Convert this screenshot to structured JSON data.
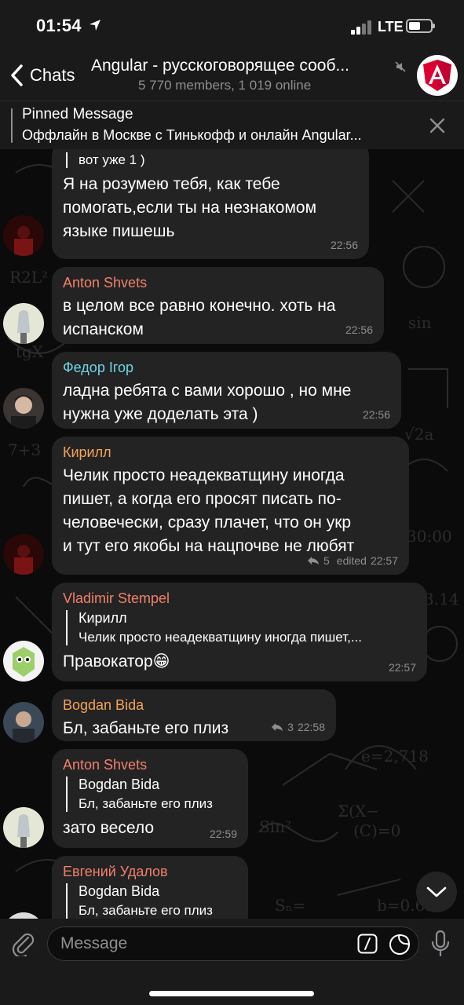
{
  "status": {
    "time": "01:54",
    "network": "LTE",
    "battery_level": 0.55
  },
  "header": {
    "back_label": "Chats",
    "title": "Angular - русскоговорящее сооб...",
    "subtitle": "5 770 members, 1 019 online"
  },
  "pinned": {
    "title": "Pinned Message",
    "text": "Оффлайн в Москве с Тинькофф и онлайн Angular..."
  },
  "messages": [
    {
      "reply_text": "вот уже 1 )",
      "text_lines": [
        "Я на розумею тебя, как тебе",
        "помогать,если ты на незнакомом",
        "языке пишешь"
      ],
      "time": "22:56"
    },
    {
      "sender": "Anton Shvets",
      "text_lines": [
        "в целом все равно конечно. хоть на",
        "испанском"
      ],
      "time": "22:56"
    },
    {
      "sender": "Федор Ігор",
      "text_lines": [
        "ладна ребята с вами хорошо , но мне",
        "нужна уже доделать эта )"
      ],
      "time": "22:56"
    },
    {
      "sender": "Кирилл",
      "text_lines": [
        "Челик просто неадекватщину иногда",
        "пишет, а когда его просят писать по-",
        "человечески, сразу плачет, что он укр",
        "и тут его якобы на нацпочве не любят"
      ],
      "replies": "5",
      "edited": "edited",
      "time": "22:57"
    },
    {
      "sender": "Vladimir Stempel",
      "reply_name": "Кирилл",
      "reply_text": "Челик просто неадекватщину иногда пишет,...",
      "text": "Правокатор😁",
      "time": "22:57"
    },
    {
      "sender": "Bogdan Bida",
      "text": "Бл, забаньте его плиз",
      "replies": "3",
      "time": "22:58"
    },
    {
      "sender": "Anton Shvets",
      "reply_name": "Bogdan Bida",
      "reply_text": "Бл, забаньте его плиз",
      "text": "зато весело",
      "time": "22:59"
    },
    {
      "sender": "Евгений Удалов",
      "reply_name": "Bogdan Bida",
      "reply_text": "Бл, забаньте его плиз"
    }
  ],
  "input": {
    "placeholder": "Message"
  },
  "colors": {
    "anton": "#f0806c",
    "fedor": "#6fd6e8",
    "kirill": "#f4a35a",
    "vladimir": "#f0806c",
    "bogdan": "#f4a35a",
    "evgeny": "#f0806c",
    "bubble": "#232323",
    "bar": "#1a1a1a"
  },
  "icons": [
    "back-chevron-icon",
    "location-arrow-icon",
    "signal-icon",
    "mute-icon",
    "angular-logo",
    "close-icon",
    "reply-arrow-icon",
    "attach-icon",
    "command-icon",
    "sticker-icon",
    "mic-icon",
    "chevron-down-icon"
  ]
}
